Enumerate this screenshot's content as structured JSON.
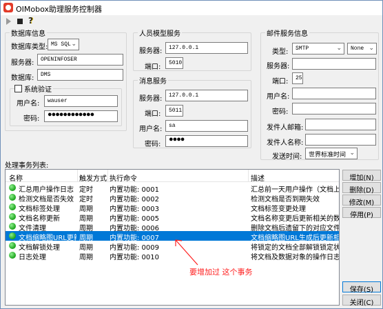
{
  "window": {
    "title": "OIMobox助理服务控制器"
  },
  "toolbar": {
    "play_icon": "play-icon",
    "stop_icon": "stop-icon",
    "help_icon": "help-icon"
  },
  "db": {
    "group_label": "数据库信息",
    "type_label": "数据库类型:",
    "type_value": "MS SQL",
    "server_label": "服务器:",
    "server_value": "OPENINFOSER",
    "database_label": "数据库:",
    "database_value": "DMS",
    "sysauth_label": "系统验证",
    "user_label": "用户名:",
    "user_value": "wauser",
    "pwd_label": "密码:",
    "pwd_value": "●●●●●●●●●●●●"
  },
  "person": {
    "group_label": "人员模型服务",
    "server_label": "服务器:",
    "server_value": "127.0.0.1",
    "port_label": "端口:",
    "port_value": "5010"
  },
  "msg": {
    "group_label": "消息服务",
    "server_label": "服务器:",
    "server_value": "127.0.0.1",
    "port_label": "端口:",
    "port_value": "5011",
    "user_label": "用户名:",
    "user_value": "sa",
    "pwd_label": "密码:",
    "pwd_value": "●●●●"
  },
  "mail": {
    "group_label": "邮件服务信息",
    "type_label": "类型:",
    "type_value": "SMTP",
    "type2_value": "None",
    "server_label": "服务器:",
    "server_value": "",
    "port_label": "端口:",
    "port_value": "25",
    "user_label": "用户名:",
    "user_value": "",
    "pwd_label": "密码:",
    "pwd_value": "",
    "sender_mail_label": "发件人邮箱:",
    "sender_mail_value": "",
    "sender_name_label": "发件人名称:",
    "sender_name_value": "",
    "time_label": "发送时间:",
    "time_value": "世界标准时间"
  },
  "tasks": {
    "label": "处理事务列表:",
    "columns": [
      "名称",
      "触发方式",
      "执行命令",
      "描述"
    ],
    "rows": [
      {
        "name": "汇总用户操作日志",
        "trigger": "定时",
        "cmd": "内置功能: 0001",
        "desc": "汇总前一天用户操作（文档上传、",
        "selected": false
      },
      {
        "name": "检测文档是否失效",
        "trigger": "定时",
        "cmd": "内置功能: 0002",
        "desc": "检测文档是否到期失效",
        "selected": false
      },
      {
        "name": "文档标签处理",
        "trigger": "周期",
        "cmd": "内置功能: 0003",
        "desc": "文档标签变更处理",
        "selected": false
      },
      {
        "name": "文档名称更新",
        "trigger": "周期",
        "cmd": "内置功能: 0005",
        "desc": "文档名称变更后更新相关的数据",
        "selected": false
      },
      {
        "name": "文件清理",
        "trigger": "周期",
        "cmd": "内置功能: 0006",
        "desc": "删除文档后遗留下的对应文件清理",
        "selected": false
      },
      {
        "name": "文档缩略图URL更新",
        "trigger": "周期",
        "cmd": "内置功能: 0007",
        "desc": "文档缩略图URL生成后更新相关的数",
        "selected": true
      },
      {
        "name": "文档解锁处理",
        "trigger": "周期",
        "cmd": "内置功能: 0009",
        "desc": "将锁定的文档全部解锁锁定状态处",
        "selected": false
      },
      {
        "name": "日志处理",
        "trigger": "周期",
        "cmd": "内置功能: 0010",
        "desc": "将文档及数据对象的操作日志集中",
        "selected": false
      }
    ]
  },
  "buttons": {
    "add": "增加(N)",
    "delete": "删除(D)",
    "edit": "修改(M)",
    "disable": "停用(P)",
    "save": "保存(S)",
    "close": "关闭(C)"
  },
  "annotation": {
    "text": "要增加过 这个事务"
  },
  "colors": {
    "selection": "#0078d7",
    "annotation": "#ff2020",
    "status_dot": "#1aa31a"
  }
}
